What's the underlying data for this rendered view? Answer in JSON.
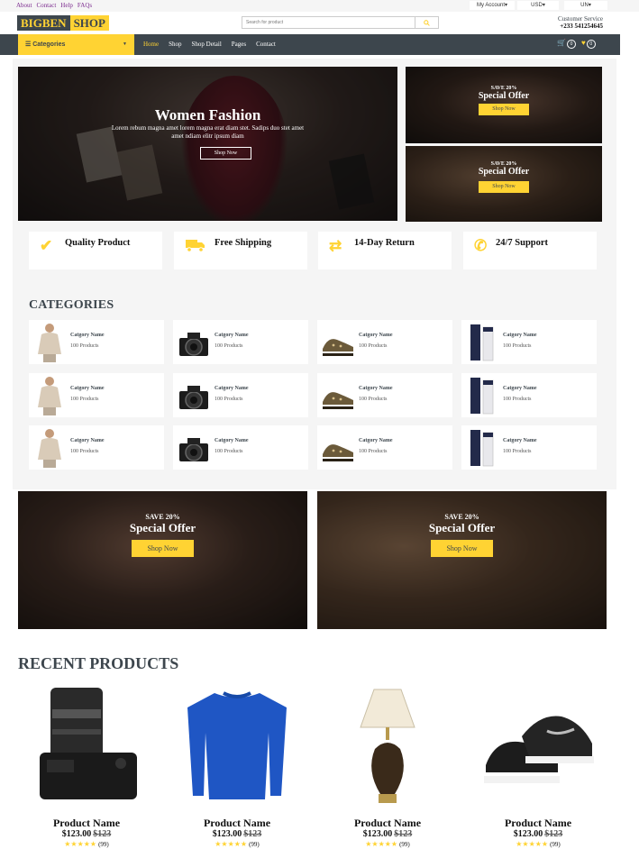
{
  "topbar": {
    "links": [
      "About",
      "Contact",
      "Help",
      "FAQs"
    ],
    "account": "My Account▾",
    "currency": "USD▾",
    "language": "UN▾"
  },
  "header": {
    "logo_part1": "BIGBEN",
    "logo_part2": "SHOP",
    "search_placeholder": "Search for product",
    "service_label": "Customer Service",
    "service_phone": "+233 541254645"
  },
  "nav": {
    "categories_label": "Categories",
    "links": [
      "Home",
      "Shop",
      "Shop Detail",
      "Pages",
      "Contact"
    ],
    "cart_count": "0",
    "wishlist_count": "0"
  },
  "hero": {
    "title": "Women Fashion",
    "subtitle": "Lorem rebum magna amet lorem magna erat diam stet. Sadips duo stet amet amet ndiam elitr ipsum diam",
    "button": "Shop Now"
  },
  "offers": [
    {
      "save": "SAVE 20%",
      "title": "Special Offer",
      "button": "Shop Now"
    },
    {
      "save": "SAVE 20%",
      "title": "Special Offer",
      "button": "Shop Now"
    },
    {
      "save": "SAVE 20%",
      "title": "Special Offer",
      "button": "Shop Now"
    },
    {
      "save": "SAVE 20%",
      "title": "Special Offer",
      "button": "Shop Now"
    }
  ],
  "features": [
    {
      "icon": "check-icon",
      "label": "Quality Product"
    },
    {
      "icon": "truck-icon",
      "label": "Free Shipping"
    },
    {
      "icon": "exchange-icon",
      "label": "14-Day Return"
    },
    {
      "icon": "phone-icon",
      "label": "24/7 Support"
    }
  ],
  "categories": {
    "title": "CATEGORIES",
    "items": [
      {
        "name": "Catgory Name",
        "count": "100 Products",
        "image": "sweater-woman"
      },
      {
        "name": "Catgory Name",
        "count": "100 Products",
        "image": "camera"
      },
      {
        "name": "Catgory Name",
        "count": "100 Products",
        "image": "shoes"
      },
      {
        "name": "Catgory Name",
        "count": "100 Products",
        "image": "cosmetics"
      },
      {
        "name": "Catgory Name",
        "count": "100 Products",
        "image": "sweater-woman"
      },
      {
        "name": "Catgory Name",
        "count": "100 Products",
        "image": "camera"
      },
      {
        "name": "Catgory Name",
        "count": "100 Products",
        "image": "shoes"
      },
      {
        "name": "Catgory Name",
        "count": "100 Products",
        "image": "cosmetics"
      },
      {
        "name": "Catgory Name",
        "count": "100 Products",
        "image": "sweater-woman"
      },
      {
        "name": "Catgory Name",
        "count": "100 Products",
        "image": "camera"
      },
      {
        "name": "Catgory Name",
        "count": "100 Products",
        "image": "shoes"
      },
      {
        "name": "Catgory Name",
        "count": "100 Products",
        "image": "cosmetics"
      }
    ]
  },
  "products": {
    "title": "RECENT PRODUCTS",
    "items": [
      {
        "name": "Product Name",
        "price": "$123.00",
        "old_price": "$123",
        "stars": "★★★★★",
        "reviews": "(99)",
        "image": "camera"
      },
      {
        "name": "Product Name",
        "price": "$123.00",
        "old_price": "$123",
        "stars": "★★★★★",
        "reviews": "(99)",
        "image": "sweater"
      },
      {
        "name": "Product Name",
        "price": "$123.00",
        "old_price": "$123",
        "stars": "★★★★★",
        "reviews": "(99)",
        "image": "lamp"
      },
      {
        "name": "Product Name",
        "price": "$123.00",
        "old_price": "$123",
        "stars": "★★★★★",
        "reviews": "(99)",
        "image": "sneakers"
      }
    ]
  },
  "colors": {
    "accent": "#ffd333",
    "dark": "#3d464d",
    "light_bg": "#f5f5f5"
  }
}
